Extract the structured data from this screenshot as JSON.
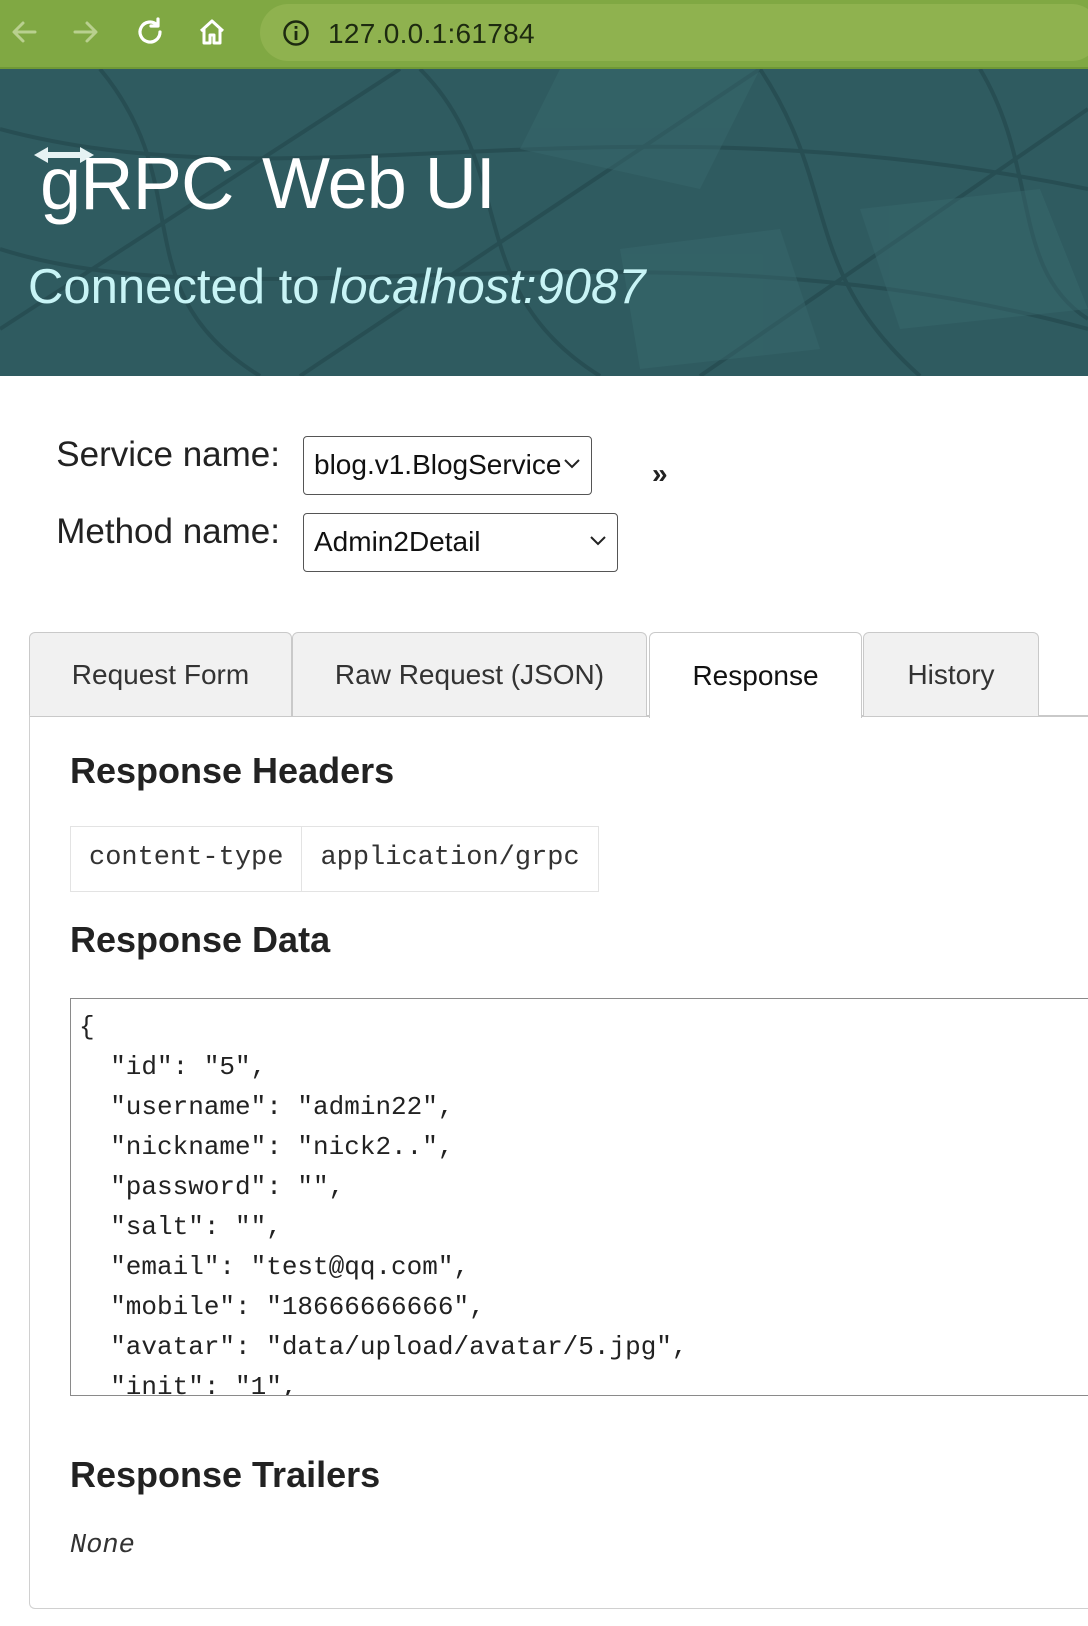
{
  "browser": {
    "url": "127.0.0.1:61784",
    "toolbar_color": "#80a843"
  },
  "header": {
    "logo_text": "gRPC",
    "title": "Web UI",
    "connected_prefix": "Connected to",
    "connected_host": "localhost:9087"
  },
  "selectors": {
    "service_label": "Service name:",
    "service_value": "blog.v1.BlogService",
    "method_label": "Method name:",
    "method_value": "Admin2Detail",
    "expand_icon": "»"
  },
  "tabs": [
    {
      "label": "Request Form",
      "active": false
    },
    {
      "label": "Raw Request (JSON)",
      "active": false
    },
    {
      "label": "Response",
      "active": true
    },
    {
      "label": "History",
      "active": false
    }
  ],
  "response": {
    "headers_title": "Response Headers",
    "headers": [
      {
        "name": "content-type",
        "value": "application/grpc"
      }
    ],
    "data_title": "Response Data",
    "data_lines": [
      "{",
      "  \"id\": \"5\",",
      "  \"username\": \"admin22\",",
      "  \"nickname\": \"nick2..\",",
      "  \"password\": \"\",",
      "  \"salt\": \"\",",
      "  \"email\": \"test@qq.com\",",
      "  \"mobile\": \"18666666666\",",
      "  \"avatar\": \"data/upload/avatar/5.jpg\",",
      "  \"init\": \"1\","
    ],
    "trailers_title": "Response Trailers",
    "trailers_value": "None"
  }
}
